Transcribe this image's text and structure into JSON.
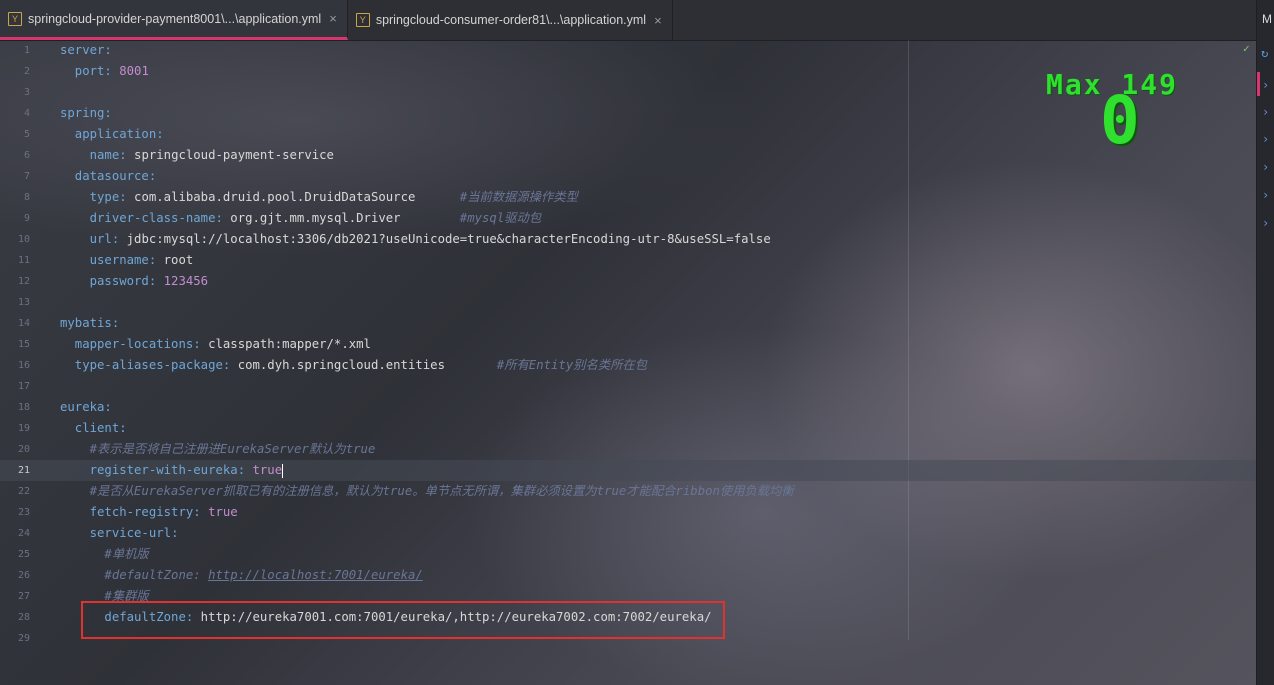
{
  "tabs": [
    {
      "icon": "yaml-file-icon",
      "icon_glyph": "Y",
      "label": "springcloud-provider-payment8001\\...\\application.yml",
      "close": "×"
    },
    {
      "icon": "yaml-file-icon",
      "icon_glyph": "Y",
      "label": "springcloud-consumer-order81\\...\\application.yml",
      "close": "×"
    }
  ],
  "right_strip": {
    "label": "M"
  },
  "overlay": {
    "max_label": "Max 149",
    "current_value": "0"
  },
  "editor": {
    "current_line": 21,
    "lines": [
      {
        "n": "1",
        "k": "server",
        "s": ":",
        "v": "",
        "c": ""
      },
      {
        "n": "2",
        "k": "  port",
        "s": ": ",
        "v": "8001",
        "c": ""
      },
      {
        "n": "3",
        "k": "",
        "s": "",
        "v": "",
        "c": ""
      },
      {
        "n": "4",
        "k": "spring",
        "s": ":",
        "v": "",
        "c": ""
      },
      {
        "n": "5",
        "k": "  application",
        "s": ":",
        "v": "",
        "c": ""
      },
      {
        "n": "6",
        "k": "    name",
        "s": ": ",
        "v": "springcloud-payment-service",
        "c": ""
      },
      {
        "n": "7",
        "k": "  datasource",
        "s": ":",
        "v": "",
        "c": ""
      },
      {
        "n": "8",
        "k": "    type",
        "s": ": ",
        "v": "com.alibaba.druid.pool.DruidDataSource",
        "c": "      #当前数据源操作类型"
      },
      {
        "n": "9",
        "k": "    driver-class-name",
        "s": ": ",
        "v": "org.gjt.mm.mysql.Driver",
        "c": "        #mysql驱动包"
      },
      {
        "n": "10",
        "k": "    url",
        "s": ": ",
        "v": "jdbc:mysql://localhost:3306/db2021?useUnicode=true&characterEncoding-utr-8&useSSL=false",
        "c": ""
      },
      {
        "n": "11",
        "k": "    username",
        "s": ": ",
        "v": "root",
        "c": ""
      },
      {
        "n": "12",
        "k": "    password",
        "s": ": ",
        "v": "123456",
        "c": ""
      },
      {
        "n": "13",
        "k": "",
        "s": "",
        "v": "",
        "c": ""
      },
      {
        "n": "14",
        "k": "mybatis",
        "s": ":",
        "v": "",
        "c": ""
      },
      {
        "n": "15",
        "k": "  mapper-locations",
        "s": ": ",
        "v": "classpath:mapper/*.xml",
        "c": ""
      },
      {
        "n": "16",
        "k": "  type-aliases-package",
        "s": ": ",
        "v": "com.dyh.springcloud.entities",
        "c": "       #所有Entity别名类所在包"
      },
      {
        "n": "17",
        "k": "",
        "s": "",
        "v": "",
        "c": ""
      },
      {
        "n": "18",
        "k": "eureka",
        "s": ":",
        "v": "",
        "c": ""
      },
      {
        "n": "19",
        "k": "  client",
        "s": ":",
        "v": "",
        "c": ""
      },
      {
        "n": "20",
        "k": "    ",
        "s": "",
        "v": "",
        "c": "#表示是否将自己注册进EurekaServer默认为true"
      },
      {
        "n": "21",
        "k": "    register-with-eureka",
        "s": ": ",
        "v": "true",
        "c": ""
      },
      {
        "n": "22",
        "k": "    ",
        "s": "",
        "v": "",
        "c": "#是否从EurekaServer抓取已有的注册信息，默认为true。单节点无所谓，集群必须设置为true才能配合ribbon使用负载均衡"
      },
      {
        "n": "23",
        "k": "    fetch-registry",
        "s": ": ",
        "v": "true",
        "c": ""
      },
      {
        "n": "24",
        "k": "    service-url",
        "s": ":",
        "v": "",
        "c": ""
      },
      {
        "n": "25",
        "k": "      ",
        "s": "",
        "v": "",
        "c": "#单机版"
      },
      {
        "n": "26",
        "k": "      ",
        "s": "",
        "v": "",
        "c": "#defaultZone: ",
        "cu": "http://localhost:7001/eureka/"
      },
      {
        "n": "27",
        "k": "      ",
        "s": "",
        "v": "",
        "c": "#集群版"
      },
      {
        "n": "28",
        "k": "      defaultZone",
        "s": ": ",
        "v": "http://eureka7001.com:7001/eureka/,http://eureka7002.com:7002/eureka/",
        "c": ""
      },
      {
        "n": "29",
        "k": "",
        "s": "",
        "v": "",
        "c": ""
      }
    ]
  }
}
